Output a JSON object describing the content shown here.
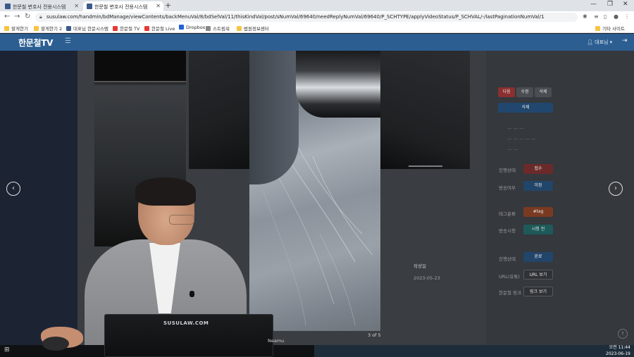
{
  "browser": {
    "tabs": [
      {
        "label": "한문철 변호사 전용시스템"
      },
      {
        "label": "한문철 변호사 전용시스템"
      }
    ],
    "url": "susulaw.com/handmin/bdManage/viewContents/backMenuVal/8/bdSelVal/11/thisKindVal/post/sNumVal/69640/needReplyNumVal/69640/P_SCHTYPE/applyVideoStatus/P_SCHVAL/-/lastPaginationNumVal/1",
    "bookmarks": [
      {
        "label": "할게한기",
        "color": "#f4c542"
      },
      {
        "label": "할게한기 2",
        "color": "#f4c542"
      },
      {
        "label": "대표님 한문시스템",
        "color": "#3a5b8a"
      },
      {
        "label": "한문철 TV",
        "color": "#e53935"
      },
      {
        "label": "한문철 Live",
        "color": "#e53935"
      },
      {
        "label": "Dropbox",
        "color": "#1f63d6"
      },
      {
        "label": "스트림워",
        "color": "#888888"
      },
      {
        "label": "법원정보센터",
        "color": "#f4c542"
      },
      {
        "label": "기타 사이트",
        "color": "#f4c542"
      }
    ]
  },
  "app": {
    "logo": "한문철TV",
    "user": "대표님",
    "accent": "#2c5e92"
  },
  "panel": {
    "action_buttons": [
      "다음",
      "수정",
      "삭제"
    ],
    "delete_button": "삭제",
    "rows": [
      {
        "label": "진행상태",
        "value": "접수"
      },
      {
        "label": "방송여부",
        "value": "미정"
      },
      {
        "label": "태그분류",
        "value": "#tag"
      },
      {
        "label": "방송시청",
        "value": "시청 전"
      },
      {
        "label": "진행상태",
        "value": "완료"
      },
      {
        "label": "URL(유튜)",
        "value": "URL 보기"
      },
      {
        "label": "한문철 링크",
        "value": "링크 보기"
      }
    ]
  },
  "table": {
    "header_left": "번호",
    "header_right": "작성일",
    "date": "2023-05-23"
  },
  "lightbox": {
    "counter": "3 of 5",
    "prev_icon": "‹",
    "next_icon": "›"
  },
  "overlay": {
    "laptop_brand": "SUSULAW.COM",
    "caption": "Neamu"
  },
  "taskbar": {
    "time": "오전 11:44",
    "date": "2023-06-19"
  }
}
